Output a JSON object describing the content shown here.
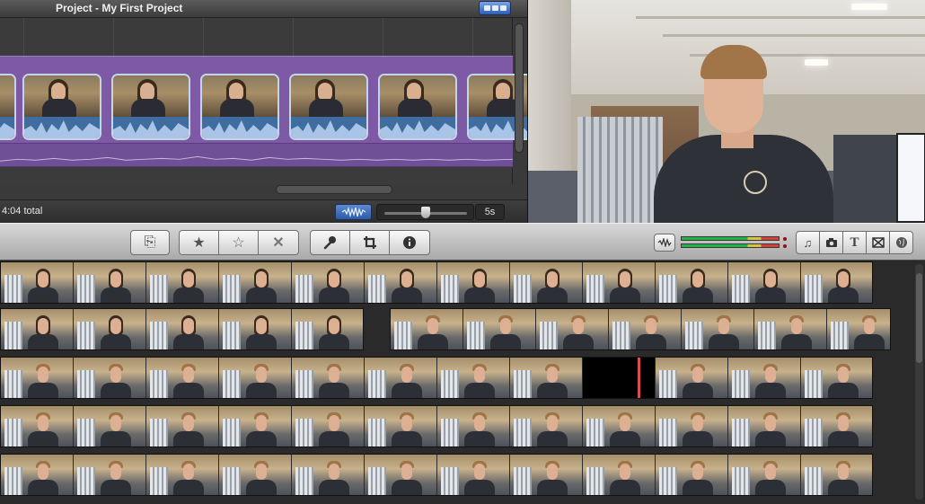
{
  "project": {
    "title": "Project - My First Project",
    "total": "4:04 total",
    "zoom_value": "5s",
    "zoom_level": 0.5
  },
  "toolbar": {
    "buttons": [
      {
        "name": "add-to-project-icon",
        "glyph": "⎘"
      },
      {
        "name": "favorite-star-icon",
        "glyph": "★"
      },
      {
        "name": "unmark-star-icon",
        "glyph": "☆"
      },
      {
        "name": "reject-x-icon",
        "glyph": "✕"
      },
      {
        "name": "voiceover-microphone-icon",
        "glyph": "🎤"
      },
      {
        "name": "crop-icon",
        "glyph": "⌗"
      },
      {
        "name": "info-icon",
        "glyph": "ⓘ"
      }
    ],
    "media": [
      {
        "name": "music-icon",
        "glyph": "♫"
      },
      {
        "name": "photo-camera-icon",
        "glyph": "◙"
      },
      {
        "name": "title-text-icon",
        "glyph": "T"
      },
      {
        "name": "transitions-icon",
        "glyph": "⊠"
      },
      {
        "name": "maps-globe-icon",
        "glyph": "◍"
      }
    ]
  },
  "colors": {
    "clip_strip": "#7e59a6",
    "audio_wave": "#3f6d9f",
    "selection_blue": "#2e5fb7"
  }
}
